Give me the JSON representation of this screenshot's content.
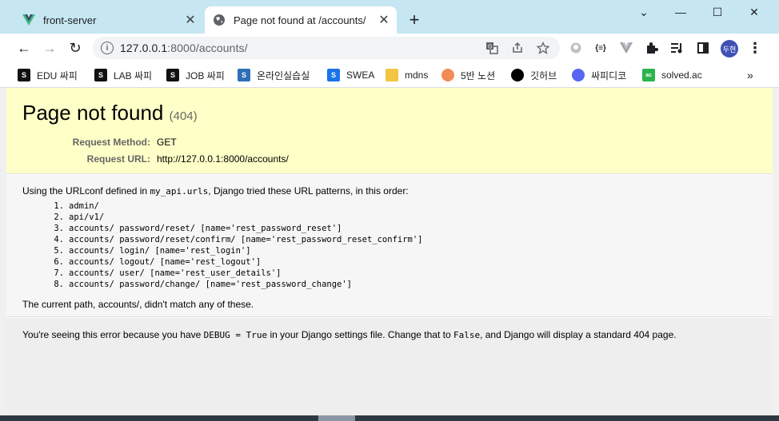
{
  "browser": {
    "tabs": [
      {
        "title": "front-server",
        "favicon": "vue-icon"
      },
      {
        "title": "Page not found at /accounts/",
        "favicon": "globe-icon"
      }
    ],
    "new_tab": "+",
    "window_controls": {
      "dropdown": "⌄",
      "minimize": "—",
      "maximize": "☐",
      "close": "✕"
    },
    "nav": {
      "back": "←",
      "forward": "→",
      "reload": "↻"
    },
    "address": {
      "host": "127.0.0.1",
      "rest": ":8000/accounts/",
      "info": "i"
    },
    "omnibox_icons": [
      "translate-icon",
      "share-icon",
      "star-icon"
    ],
    "extensions": [
      "github-ext-icon",
      "json-ext-icon",
      "vue-ext-icon",
      "puzzle-icon",
      "media-icon",
      "sidepanel-icon"
    ],
    "extension_glyphs": {
      "json": "{≡}"
    },
    "profile_initials": "두현",
    "menu": "⋮"
  },
  "bookmarks": [
    {
      "label": "EDU 싸피",
      "icon": "ssafy-icon",
      "color": "#111111"
    },
    {
      "label": "LAB 싸피",
      "icon": "ssafy-icon",
      "color": "#111111"
    },
    {
      "label": "JOB 싸피",
      "icon": "ssafy-icon",
      "color": "#111111"
    },
    {
      "label": "온라인실습실",
      "icon": "ssafy-blue-icon",
      "color": "#2d6fb7"
    },
    {
      "label": "SWEA",
      "icon": "swea-icon",
      "color": "#1a73e8"
    },
    {
      "label": "mdns",
      "icon": "folder-icon",
      "color": "#f4c542"
    },
    {
      "label": "5반 노션",
      "icon": "peach-icon",
      "color": "#f28b54"
    },
    {
      "label": "깃허브",
      "icon": "github-icon",
      "color": "#000000"
    },
    {
      "label": "싸피디코",
      "icon": "discord-icon",
      "color": "#5865f2"
    },
    {
      "label": "solved.ac",
      "icon": "solvedac-icon",
      "color": "#2ab34a"
    }
  ],
  "bookmarks_more": "»",
  "django": {
    "title": "Page not found",
    "code": "(404)",
    "request_method_label": "Request Method:",
    "request_method": "GET",
    "request_url_label": "Request URL:",
    "request_url": "http://127.0.0.1:8000/accounts/",
    "intro_pre": "Using the URLconf defined in ",
    "urlconf": "my_api.urls",
    "intro_post": ", Django tried these URL patterns, in this order:",
    "patterns": [
      "admin/",
      "api/v1/",
      "accounts/ password/reset/ [name='rest_password_reset']",
      "accounts/ password/reset/confirm/ [name='rest_password_reset_confirm']",
      "accounts/ login/ [name='rest_login']",
      "accounts/ logout/ [name='rest_logout']",
      "accounts/ user/ [name='rest_user_details']",
      "accounts/ password/change/ [name='rest_password_change']"
    ],
    "current_path_pre": "The current path, ",
    "current_path": "accounts/",
    "current_path_post": ", didn't match any of these.",
    "explanation_pre": "You're seeing this error because you have ",
    "debug_code": "DEBUG = True",
    "explanation_mid": " in your Django settings file. Change that to ",
    "false_code": "False",
    "explanation_post": ", and Django will display a standard 404 page."
  },
  "colors": {
    "tabstrip": "#c6e6f2",
    "summary_bg": "#ffffc8",
    "info_bg": "#f6f6f6",
    "explanation_bg": "#eeeeee"
  }
}
